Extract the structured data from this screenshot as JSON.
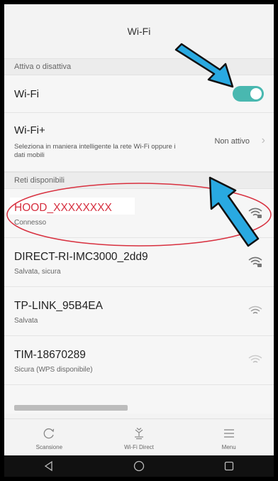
{
  "header": {
    "title": "Wi-Fi"
  },
  "toggle_section": {
    "label": "Attiva o disattiva"
  },
  "wifi_toggle": {
    "label": "Wi-Fi",
    "on": true
  },
  "wifi_plus": {
    "title": "Wi-Fi+",
    "description": "Seleziona in maniera intelligente la rete Wi-Fi oppure i dati mobili",
    "status": "Non attivo"
  },
  "networks_section": {
    "label": "Reti disponibili"
  },
  "networks": [
    {
      "name": "HOOD_XXXXXXXX",
      "status": "Connesso"
    },
    {
      "name": "DIRECT-RI-IMC3000_2dd9",
      "status": "Salvata, sicura"
    },
    {
      "name": "TP-LINK_95B4EA",
      "status": "Salvata"
    },
    {
      "name": "TIM-18670289",
      "status": "Sicura (WPS disponibile)"
    }
  ],
  "bottom_actions": [
    {
      "label": "Scansione",
      "icon": "refresh-icon"
    },
    {
      "label": "Wi-Fi Direct",
      "icon": "wifi-direct-icon"
    },
    {
      "label": "Menu",
      "icon": "menu-icon"
    }
  ],
  "nav_icons": [
    "back-icon",
    "home-icon",
    "recents-icon"
  ],
  "colors": {
    "accent": "#49b8b0",
    "connected": "#d63040",
    "arrow": "#29a9e1",
    "highlight": "#d8303f"
  }
}
